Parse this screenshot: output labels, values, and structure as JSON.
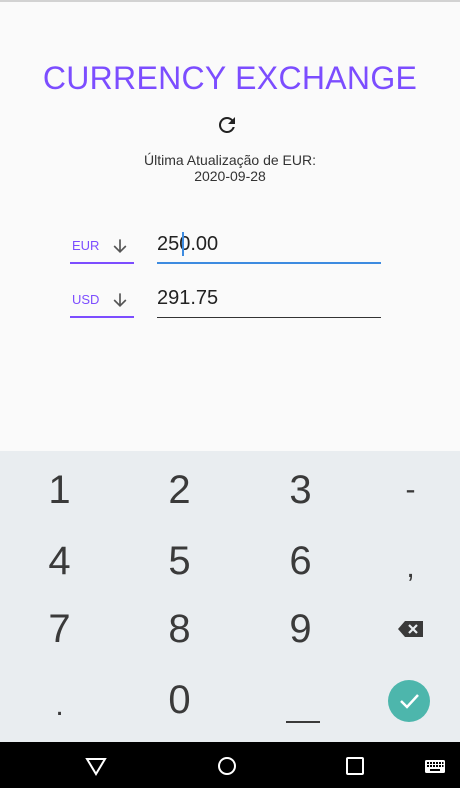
{
  "app": {
    "title": "CURRENCY EXCHANGE",
    "last_update_label": "Última Atualização de EUR:",
    "last_update_date": "2020-09-28",
    "primary_color": "#7c4dff",
    "focus_color": "#3d8be0"
  },
  "conversions": [
    {
      "currency": "EUR",
      "amount": "250.00",
      "focused": true
    },
    {
      "currency": "USD",
      "amount": "291.75",
      "focused": false
    }
  ],
  "keyboard": {
    "rows": [
      [
        "1",
        "2",
        "3",
        "-"
      ],
      [
        "4",
        "5",
        "6",
        ","
      ],
      [
        "7",
        "8",
        "9",
        "backspace-icon"
      ],
      [
        ".",
        "0",
        "_",
        "check-icon"
      ]
    ],
    "accent_color": "#4db6ac",
    "background": "#e9edf0"
  },
  "navbar": {
    "icons": [
      "back-triangle-icon",
      "home-circle-icon",
      "recents-square-icon",
      "keyboard-icon"
    ]
  }
}
